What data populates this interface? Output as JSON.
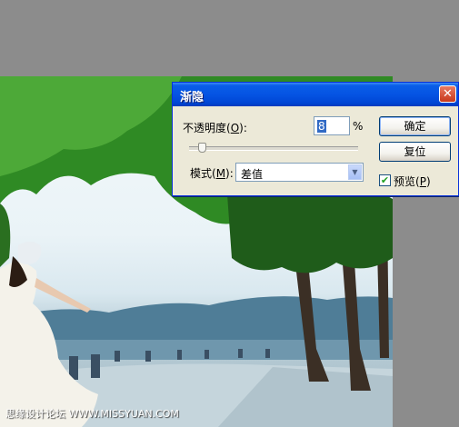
{
  "dialog": {
    "title": "渐隐",
    "close_glyph": "✕",
    "opacity_label_prefix": "不透明度(",
    "opacity_label_key": "O",
    "opacity_label_suffix": "):",
    "opacity_value": "8",
    "opacity_unit": "%",
    "opacity_slider_percent": 8,
    "mode_label_prefix": "模式(",
    "mode_label_key": "M",
    "mode_label_suffix": "):",
    "mode_value": "差值",
    "ok_label": "确定",
    "reset_label": "复位",
    "preview_label_prefix": "预览(",
    "preview_label_key": "P",
    "preview_label_suffix": ")",
    "preview_checked": true,
    "check_glyph": "✔",
    "dropdown_glyph": "▼"
  },
  "watermark": "思缘设计论坛 WWW.MISSYUAN.COM",
  "colors": {
    "titlebar": "#0554e3",
    "dialog_bg": "#ece9d8",
    "workspace_bg": "#8c8c8c",
    "foliage": "#2e8a22",
    "water": "#3e6a8a"
  },
  "icons": {
    "close": "close-icon",
    "dropdown": "chevron-down-icon",
    "checkbox": "checkmark-icon"
  }
}
